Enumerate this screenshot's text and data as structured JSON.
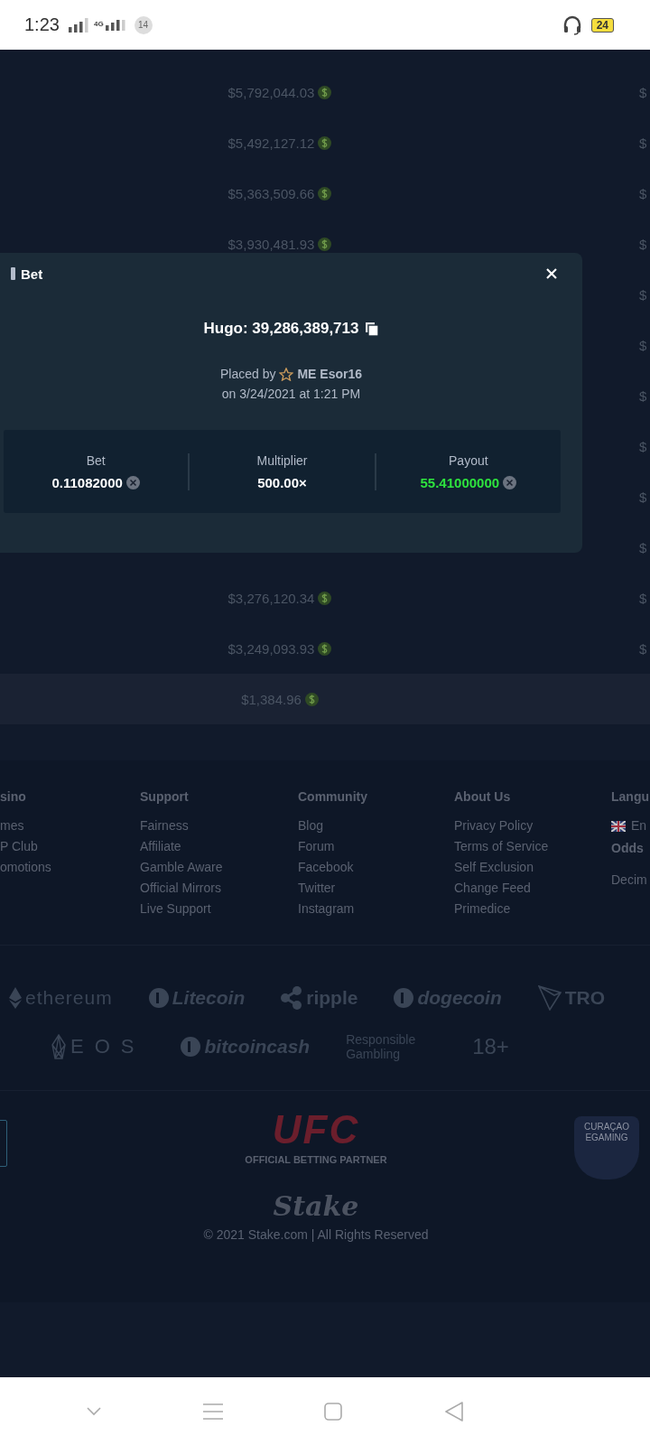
{
  "status_bar": {
    "time": "1:23",
    "network": "4G",
    "notification_count": "14",
    "battery": "24"
  },
  "table": {
    "rows": [
      {
        "amount": "$5,792,044.03",
        "column_2": "$"
      },
      {
        "amount": "$5,492,127.12",
        "column_2": "$"
      },
      {
        "amount": "$5,363,509.66",
        "column_2": "$"
      },
      {
        "amount": "$3,930,481.93",
        "column_2": "$"
      },
      {
        "column_2": "$"
      },
      {
        "column_2": "$"
      },
      {
        "column_2": "$"
      },
      {
        "column_2": "$"
      },
      {
        "column_2": "$"
      },
      {
        "column_2": "$"
      },
      {
        "amount": "$3,276,120.34",
        "column_2": "$"
      },
      {
        "amount": "$3,249,093.93",
        "column_2": "$"
      },
      {
        "amount": "$1,384.96",
        "band": true
      }
    ]
  },
  "modal": {
    "title": "Bet",
    "bet_id": "Hugo: 39,286,389,713",
    "placed_by": "Placed by",
    "user": "ME Esor16",
    "date": "on 3/24/2021 at 1:21 PM",
    "stats": [
      {
        "label": "Bet",
        "value": "0.11082000",
        "currency_icon": true,
        "win": false
      },
      {
        "label": "Multiplier",
        "value": "500.00×",
        "currency_icon": false,
        "win": false
      },
      {
        "label": "Payout",
        "value": "55.41000000",
        "currency_icon": true,
        "win": true
      }
    ]
  },
  "footer": {
    "columns": [
      {
        "heading": "sino",
        "items": [
          {
            "kind": "link",
            "text": "mes"
          },
          {
            "kind": "link",
            "text": "P Club"
          },
          {
            "kind": "link",
            "text": "omotions"
          }
        ]
      },
      {
        "heading": "Support",
        "items": [
          {
            "kind": "link",
            "text": "Fairness"
          },
          {
            "kind": "link",
            "text": "Affiliate"
          },
          {
            "kind": "link",
            "text": "Gamble Aware"
          },
          {
            "kind": "link",
            "text": "Official Mirrors"
          },
          {
            "kind": "link",
            "text": "Live Support"
          }
        ]
      },
      {
        "heading": "Community",
        "items": [
          {
            "kind": "link",
            "text": "Blog"
          },
          {
            "kind": "link",
            "text": "Forum"
          },
          {
            "kind": "link",
            "text": "Facebook"
          },
          {
            "kind": "link",
            "text": "Twitter"
          },
          {
            "kind": "link",
            "text": "Instagram"
          }
        ]
      },
      {
        "heading": "About Us",
        "items": [
          {
            "kind": "link",
            "text": "Privacy Policy"
          },
          {
            "kind": "link",
            "text": "Terms of Service"
          },
          {
            "kind": "link",
            "text": "Self Exclusion"
          },
          {
            "kind": "link",
            "text": "Change Feed"
          },
          {
            "kind": "link",
            "text": "Primedice"
          }
        ]
      },
      {
        "heading": "Langu",
        "items": [
          {
            "kind": "language",
            "text": "En"
          },
          {
            "kind": "subheading",
            "text": "Odds"
          },
          {
            "kind": "setting",
            "text": "Decim"
          }
        ]
      }
    ],
    "logo_rows": [
      [
        {
          "kind": "ethereum",
          "text": "ethereum"
        },
        {
          "kind": "litecoin",
          "text": "Litecoin"
        },
        {
          "kind": "ripple",
          "text": "ripple"
        },
        {
          "kind": "dogecoin",
          "text": "dogecoin"
        },
        {
          "kind": "tron",
          "text": "TRO"
        }
      ],
      [
        {
          "kind": "eos",
          "text": "EOS"
        },
        {
          "kind": "bitcoincash",
          "text": "bitcoincash"
        },
        {
          "kind": "responsible",
          "text": "Responsible Gambling"
        },
        {
          "kind": "age",
          "text": "18+"
        }
      ]
    ],
    "partner": {
      "logo": "UFC",
      "tagline": "OFFICIAL BETTING PARTNER"
    },
    "license_badge": "CURAÇAO EGAMING",
    "brand": "Stake",
    "copyright": "© 2021 Stake.com | All Rights Reserved"
  }
}
